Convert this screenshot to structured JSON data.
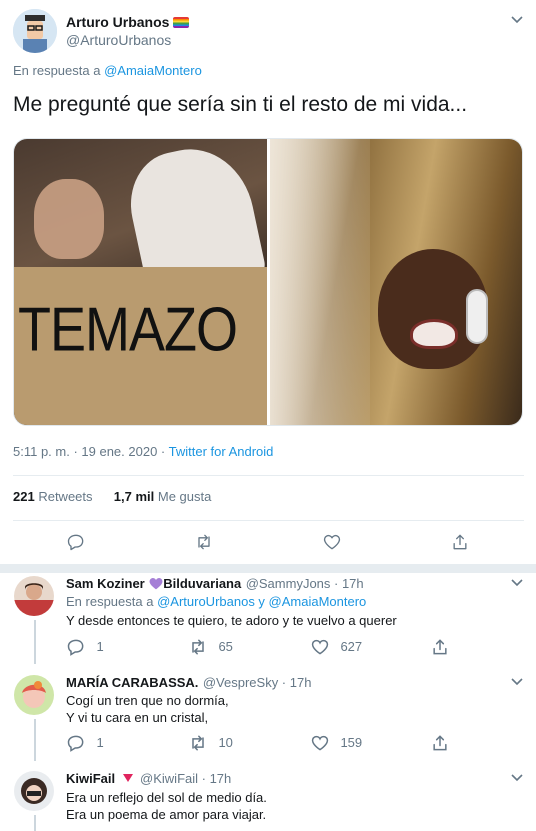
{
  "main": {
    "name": "Arturo Urbanos",
    "handle": "@ArturoUrbanos",
    "reply_prefix": "En respuesta a",
    "reply_to": "@AmaiaMontero",
    "text": "Me pregunté que sería sin ti el resto de mi vida...",
    "media_left_text": "TEMAZO",
    "time": "5:11 p. m. · 19 ene. 2020 ·",
    "source": "Twitter for Android",
    "retweets_count": "221",
    "retweets_label": "Retweets",
    "likes_count": "1,7 mil",
    "likes_label": "Me gusta"
  },
  "replies": [
    {
      "name": "Sam Koziner",
      "name_suffix": "Bilduvariana",
      "handle_time": "@SammyJons · 17h",
      "reply_prefix": "En respuesta a",
      "reply_to": "@ArturoUrbanos y @AmaiaMontero",
      "text": "Y desde entonces te quiero, te adoro y te vuelvo a querer",
      "reply_count": "1",
      "retweet_count": "65",
      "like_count": "627"
    },
    {
      "name": "MARÍA CARABASSA.",
      "handle_time": "@VespreSky · 17h",
      "line1": "Cogí un tren que no dormía,",
      "line2": "Y vi tu cara en un cristal,",
      "reply_count": "1",
      "retweet_count": "10",
      "like_count": "159"
    },
    {
      "name": "KiwiFail",
      "handle_time": "@KiwiFail · 17h",
      "line1": "Era un reflejo del sol de medio día.",
      "line2": "Era un poema de amor para viajar."
    }
  ],
  "colors": {
    "accent": "#1b95e0",
    "muted": "#657786",
    "border": "#e6ecf0",
    "heart": "#e0245e"
  },
  "icons": [
    "chevron-down-icon",
    "reply-icon",
    "retweet-icon",
    "like-icon",
    "share-icon",
    "purple-heart-icon",
    "red-triangle-icon",
    "rainbow-flag-icon"
  ]
}
